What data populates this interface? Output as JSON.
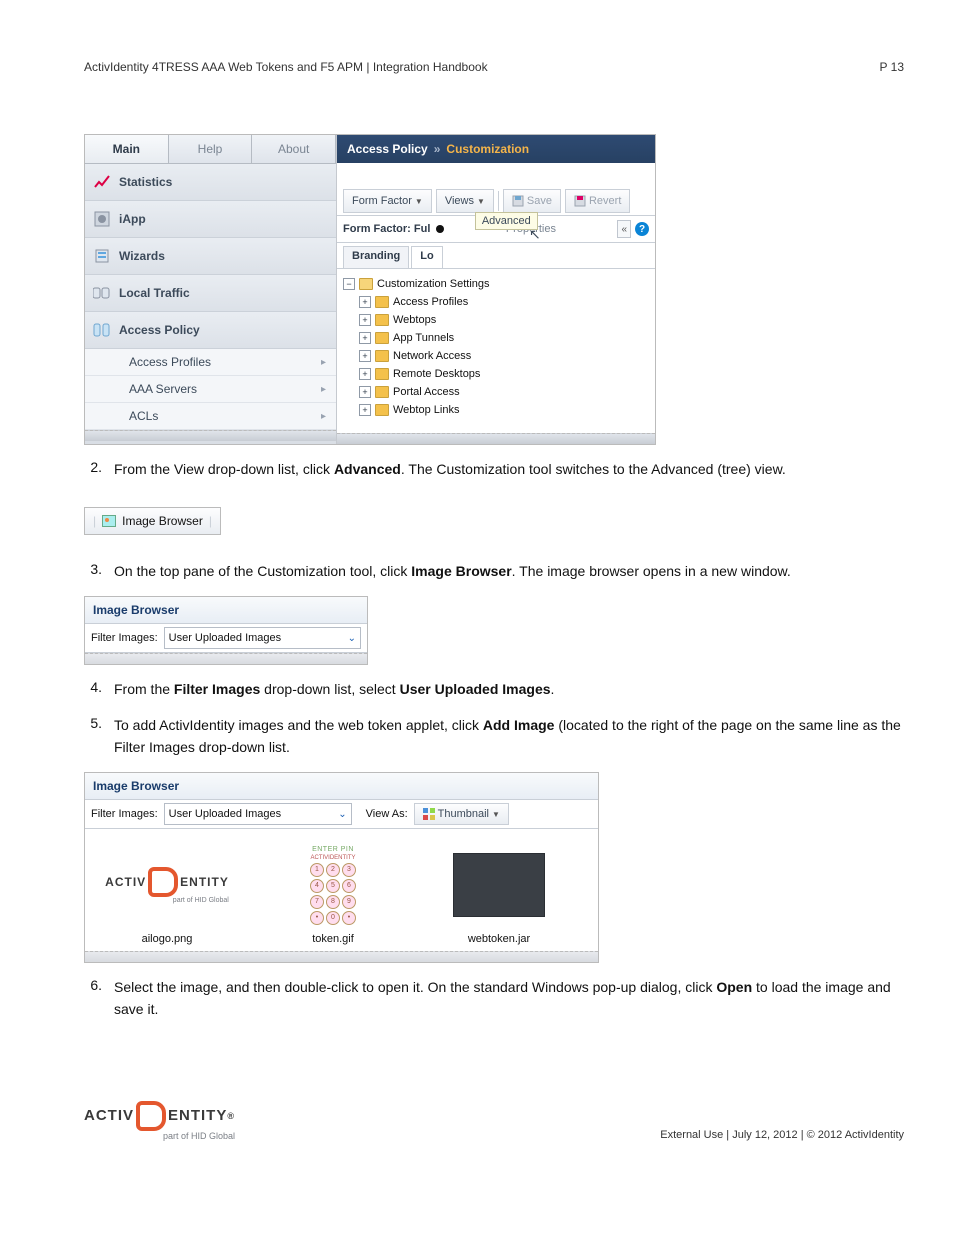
{
  "page_header": {
    "title": "ActivIdentity 4TRESS AAA Web Tokens and F5 APM | Integration Handbook",
    "page_label": "P 13"
  },
  "shot1": {
    "left_tabs": [
      "Main",
      "Help",
      "About"
    ],
    "nav": {
      "statistics": "Statistics",
      "iapp": "iApp",
      "wizards": "Wizards",
      "local_traffic": "Local Traffic",
      "access_policy": "Access Policy",
      "access_policy_children": [
        "Access Profiles",
        "AAA Servers",
        "ACLs"
      ]
    },
    "crumb": {
      "root": "Access Policy",
      "sep": "»",
      "current": "Customization"
    },
    "toolbar": {
      "form_factor": "Form Factor",
      "views": "Views",
      "save": "Save",
      "revert": "Revert"
    },
    "row2": {
      "form_factor_full": "Form Factor: Ful",
      "properties": "Properties",
      "collapse": "«"
    },
    "tabs": {
      "branding": "Branding",
      "lo": "Lo"
    },
    "advanced_tooltip": "Advanced",
    "tree": {
      "root": "Customization Settings",
      "children": [
        "Access Profiles",
        "Webtops",
        "App Tunnels",
        "Network Access",
        "Remote Desktops",
        "Portal Access",
        "Webtop Links"
      ]
    }
  },
  "step2": {
    "num": "2.",
    "prefix": "From the View drop-down list, click ",
    "bold": "Advanced",
    "suffix": ". The Customization tool switches to the Advanced (tree) view."
  },
  "shot2": {
    "label": "Image Browser"
  },
  "step3": {
    "num": "3.",
    "prefix": "On the top pane of the Customization tool, click ",
    "bold": "Image Browser",
    "suffix": ". The image browser opens in a new window."
  },
  "shot3": {
    "title": "Image Browser",
    "filter_label": "Filter Images:",
    "filter_value": "User Uploaded Images"
  },
  "step4": {
    "num": "4.",
    "prefix": "From the ",
    "bold1": "Filter Images",
    "mid": " drop-down list, select ",
    "bold2": "User Uploaded Images",
    "suffix": "."
  },
  "step5": {
    "num": "5.",
    "prefix": "To add ActivIdentity images and the web token applet, click ",
    "bold": "Add Image",
    "suffix": " (located to the right of the page on the same line as the Filter Images drop-down list."
  },
  "shot4": {
    "title": "Image Browser",
    "filter_label": "Filter Images:",
    "filter_value": "User Uploaded Images",
    "viewas_label": "View As:",
    "viewas_value": "Thumbnail",
    "keypad_title": "ENTER PIN",
    "keypad_brand": "ACTIVIDENTITY",
    "thumbs": [
      "ailogo.png",
      "token.gif",
      "webtoken.jar"
    ]
  },
  "step6": {
    "num": "6.",
    "prefix": "Select the image, and then double-click to open it. On the standard Windows pop-up dialog, click ",
    "bold": "Open",
    "suffix": " to load the image and save it."
  },
  "footer": {
    "brand_left": "ACTIV",
    "brand_right": "ENTITY",
    "brand_reg": "®",
    "brand_sub": "part of HID Global",
    "right": "External Use | July 12, 2012 | © 2012 ActivIdentity"
  }
}
